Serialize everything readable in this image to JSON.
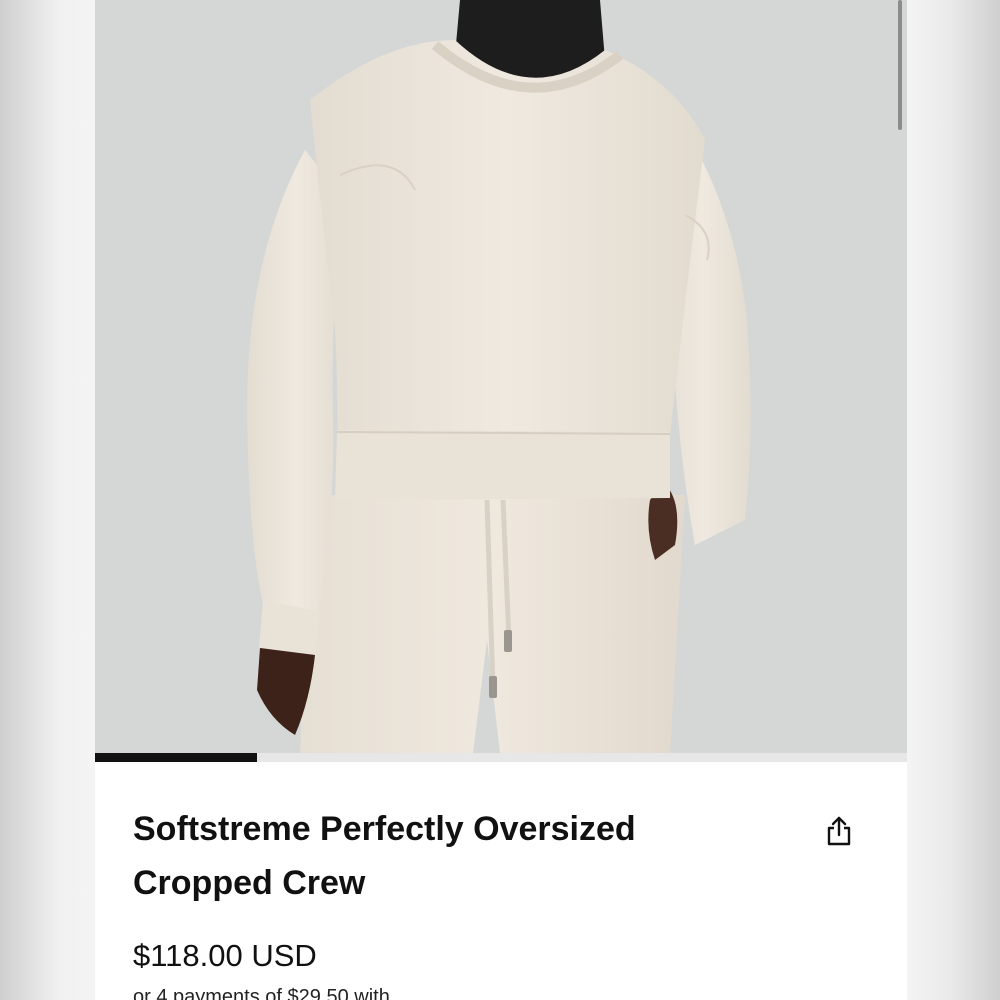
{
  "product": {
    "title": "Softstreme Perfectly Oversized Cropped Crew",
    "price": "$118.00 USD",
    "installments_text": "or 4 payments of $29.50 with"
  },
  "gallery": {
    "image_description_icon": "product-photo",
    "progress_fraction": 0.2
  },
  "icons": {
    "share": "share-icon"
  },
  "colors": {
    "text": "#111111",
    "progress": "#111111",
    "track": "#e7e7e7",
    "garment": "#ece6dc",
    "backdrop": "#d4d6d5"
  }
}
